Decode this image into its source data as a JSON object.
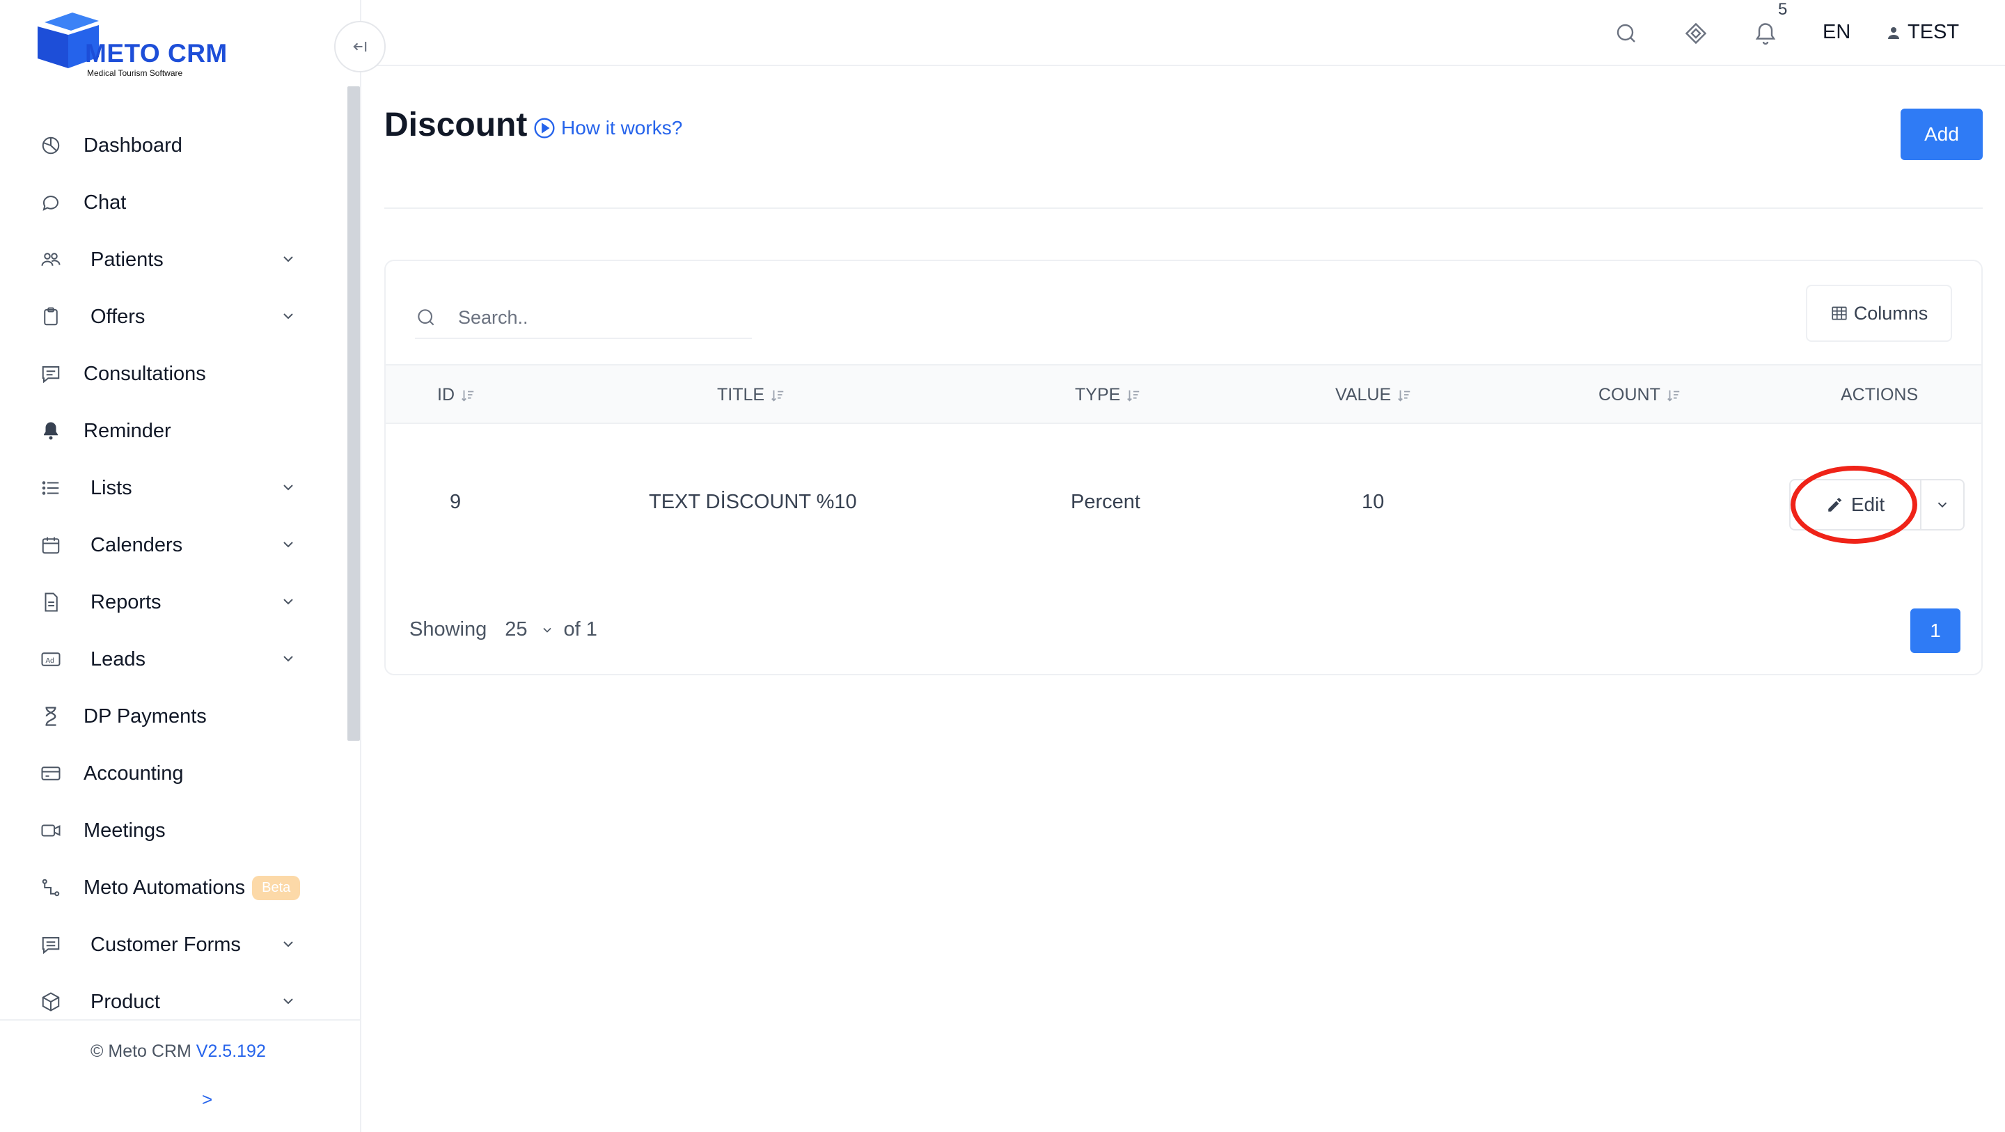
{
  "brand": {
    "name": "METO CRM",
    "tagline": "Medical Tourism Software",
    "color": "#1d4ed8"
  },
  "sidebar": {
    "items": [
      {
        "label": "Dashboard",
        "icon": "pie-chart-icon",
        "expandable": false
      },
      {
        "label": "Chat",
        "icon": "chat-bubble-icon",
        "expandable": false
      },
      {
        "label": "Patients",
        "icon": "users-icon",
        "expandable": true
      },
      {
        "label": "Offers",
        "icon": "clipboard-icon",
        "expandable": true
      },
      {
        "label": "Consultations",
        "icon": "message-square-icon",
        "expandable": false
      },
      {
        "label": "Reminder",
        "icon": "bell-filled-icon",
        "expandable": false
      },
      {
        "label": "Lists",
        "icon": "list-icon",
        "expandable": true
      },
      {
        "label": "Calenders",
        "icon": "calendar-icon",
        "expandable": true
      },
      {
        "label": "Reports",
        "icon": "document-icon",
        "expandable": true
      },
      {
        "label": "Leads",
        "icon": "ad-icon",
        "expandable": true
      },
      {
        "label": "DP Payments",
        "icon": "hourglass-icon",
        "expandable": false
      },
      {
        "label": "Accounting",
        "icon": "credit-card-icon",
        "expandable": false
      },
      {
        "label": "Meetings",
        "icon": "video-camera-icon",
        "expandable": false
      },
      {
        "label": "Meto Automations",
        "icon": "automation-icon",
        "expandable": false,
        "badge": "Beta"
      },
      {
        "label": "Customer Forms",
        "icon": "form-icon",
        "expandable": true
      },
      {
        "label": "Product",
        "icon": "box-icon",
        "expandable": true
      }
    ],
    "footer": {
      "copyright": "© Meto CRM",
      "version": "V2.5.192",
      "expand_label": ">"
    }
  },
  "topbar": {
    "notification_count": "5",
    "language": "EN",
    "user_name": "TEST"
  },
  "page": {
    "title": "Discount",
    "help_link": "How it works?",
    "add_label": "Add"
  },
  "table": {
    "search_placeholder": "Search..",
    "columns_label": "Columns",
    "headers": {
      "id": "ID",
      "title": "TITLE",
      "type": "TYPE",
      "value": "VALUE",
      "count": "COUNT",
      "actions": "ACTIONS"
    },
    "rows": [
      {
        "id": "9",
        "title": "TEXT DİSCOUNT %10",
        "type": "Percent",
        "value": "10",
        "count": "",
        "action_label": "Edit"
      }
    ],
    "footer": {
      "showing_label": "Showing",
      "page_size": "25",
      "of_label": "of 1",
      "current_page": "1"
    }
  },
  "colors": {
    "primary": "#2f7bf5",
    "highlight_circle": "#ef2318",
    "beta_badge": "#fcd9a8"
  }
}
